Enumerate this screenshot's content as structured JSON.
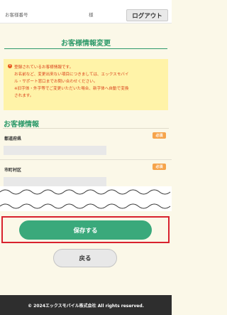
{
  "header": {
    "customer_number_label": "お客様番号",
    "customer_suffix": "様",
    "logout_label": "ログアウト"
  },
  "page": {
    "title": "お客様情報変更"
  },
  "notice": {
    "line1": "登録されているお客様情報です。",
    "line2": "お名前など、変更出来ない項目につきましては、エックスモバイ",
    "line3": "ル・サポート窓口までお問い合わせください。",
    "line4": "※旧字体・外字等でご変更いただいた場合、新字体へ自動で変換",
    "line5": "されます。"
  },
  "customer_info": {
    "section_title": "お客様情報",
    "fields": [
      {
        "label": "都道府県",
        "required_badge": "必須",
        "value": ""
      },
      {
        "label": "市町村区",
        "required_badge": "必須",
        "value": ""
      }
    ]
  },
  "actions": {
    "save_label": "保存する",
    "back_label": "戻る"
  },
  "footer": {
    "copyright": "© 2024エックスモバイル株式会社 All rights reserved."
  },
  "colors": {
    "brand_green": "#2e9a6a",
    "notice_bg": "#fff3a8",
    "notice_text": "#d9401a",
    "required_badge": "#f6a44b",
    "highlight_red": "#d8222e",
    "page_bg": "#fbf8e8"
  }
}
